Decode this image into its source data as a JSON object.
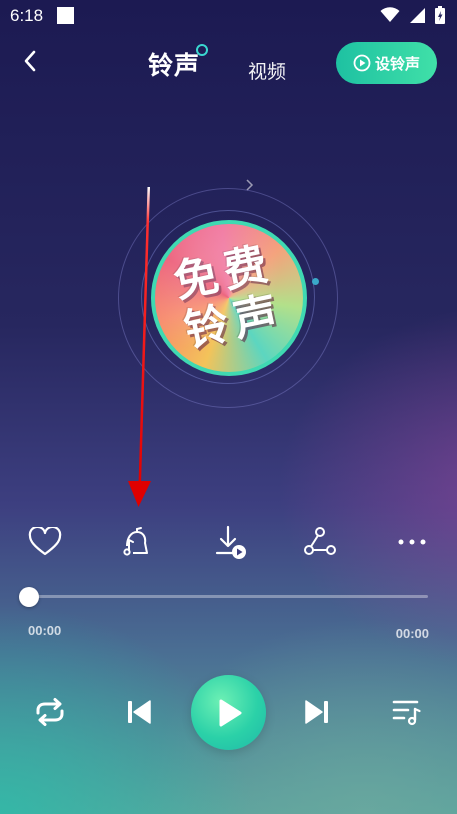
{
  "status_bar": {
    "time": "6:18",
    "icons": [
      "notification-square-icon",
      "wifi-icon",
      "cell-signal-icon",
      "battery-icon"
    ]
  },
  "header": {
    "tabs": [
      {
        "label": "铃声",
        "active": true
      },
      {
        "label": "视频",
        "active": false
      }
    ],
    "set_ringtone_label": "设铃声"
  },
  "disc": {
    "cover_line1": "免费",
    "cover_line2": "铃声"
  },
  "actions": [
    {
      "name": "favorite",
      "icon": "heart-icon"
    },
    {
      "name": "ringtone-tool",
      "icon": "bell-music-icon"
    },
    {
      "name": "download",
      "icon": "download-play-icon"
    },
    {
      "name": "share",
      "icon": "share-icon"
    },
    {
      "name": "more",
      "icon": "more-dots-icon"
    }
  ],
  "progress": {
    "current_time": "00:00",
    "total_time": "00:00",
    "fraction": 0.0
  },
  "controls": {
    "icons": [
      "repeat-icon",
      "previous-icon",
      "play-icon",
      "next-icon",
      "playlist-icon"
    ]
  },
  "colors": {
    "accent": "#2fd3a8",
    "annotation_red": "#e00000",
    "background_top": "#1c1a52",
    "background_bottom": "#5aa39d"
  }
}
